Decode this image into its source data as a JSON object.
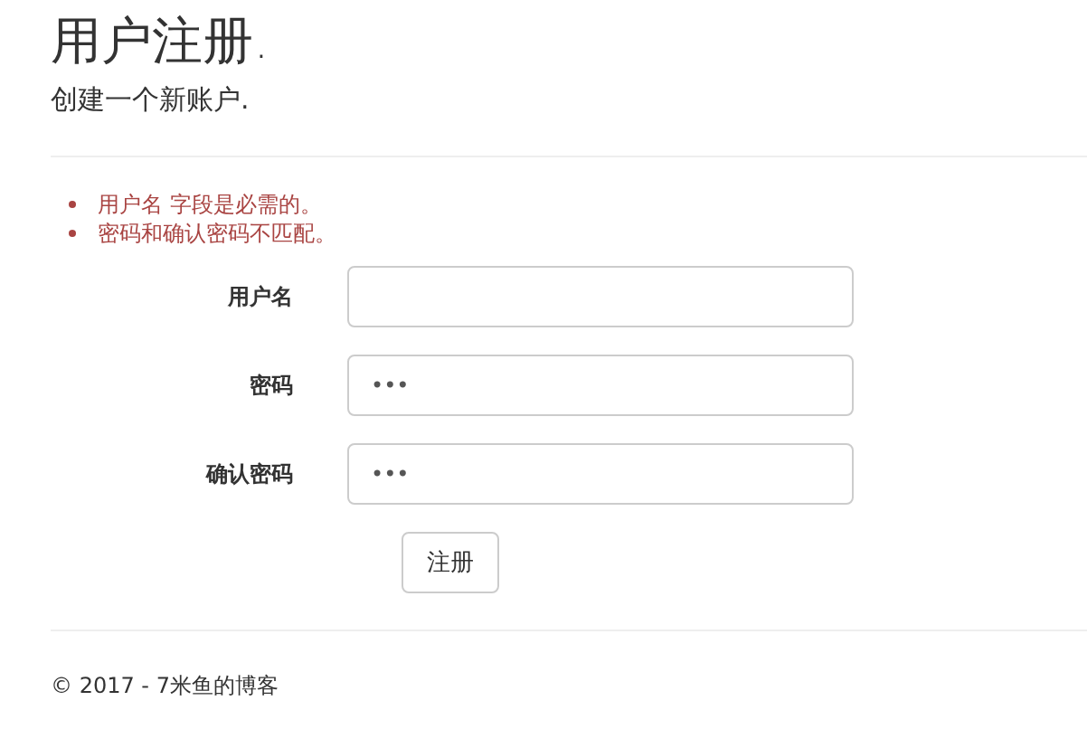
{
  "page": {
    "title": "用户注册.",
    "subtitle": "创建一个新账户."
  },
  "errors": [
    "用户名 字段是必需的。",
    "密码和确认密码不匹配。"
  ],
  "fields": [
    {
      "label": "用户名"
    },
    {
      "label": "密码",
      "value": "•••"
    },
    {
      "label": "确认密码",
      "value": "•••"
    }
  ],
  "submit_button": "注册",
  "footer": "© 2017 - 7米鱼的博客"
}
